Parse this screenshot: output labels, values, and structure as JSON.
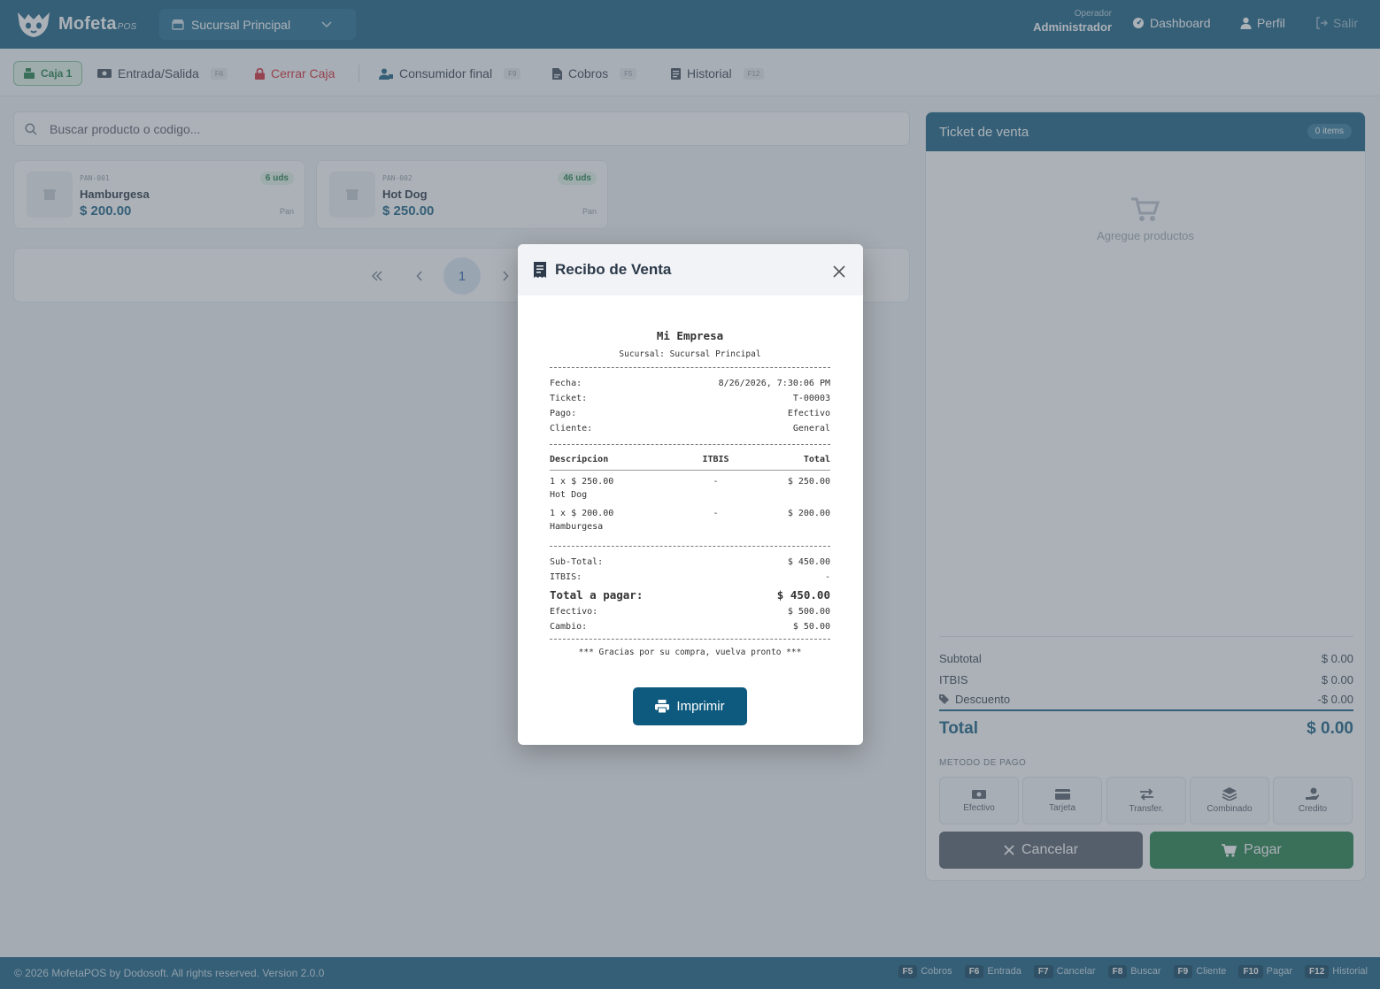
{
  "app": {
    "name": "Mofeta",
    "suffix": "POS"
  },
  "header": {
    "branch": "Sucursal Principal",
    "operator_label": "Operador",
    "operator_name": "Administrador",
    "dashboard": "Dashboard",
    "profile": "Perfil",
    "logout": "Salir"
  },
  "toolbar": {
    "register": "Caja 1",
    "cash_io": "Entrada/Salida",
    "cash_io_key": "F6",
    "close_register": "Cerrar Caja",
    "customer": "Consumidor final",
    "customer_key": "F9",
    "charges": "Cobros",
    "charges_key": "F5",
    "history": "Historial",
    "history_key": "F12"
  },
  "search": {
    "placeholder": "Buscar producto o codigo..."
  },
  "products": [
    {
      "sku": "PAN-001",
      "name": "Hamburgesa",
      "price": "$ 200.00",
      "stock": "6 uds",
      "category": "Pan"
    },
    {
      "sku": "PAN-002",
      "name": "Hot Dog",
      "price": "$ 250.00",
      "stock": "46 uds",
      "category": "Pan"
    }
  ],
  "pagination": {
    "current": "1"
  },
  "ticket": {
    "title": "Ticket de venta",
    "count": "0 items",
    "empty": "Agregue productos",
    "subtotal_label": "Subtotal",
    "subtotal": "$ 0.00",
    "tax_label": "ITBIS",
    "tax": "$ 0.00",
    "discount_label": "Descuento",
    "discount": "-$ 0.00",
    "total_label": "Total",
    "total": "$ 0.00",
    "payment_label": "METODO DE PAGO",
    "methods": [
      "Efectivo",
      "Tarjeta",
      "Transfer.",
      "Combinado",
      "Credito"
    ],
    "cancel": "Cancelar",
    "pay": "Pagar"
  },
  "footer": {
    "copyright": "© 2026 MofetaPOS by Dodosoft. All rights reserved. Version 2.0.0",
    "keys": [
      {
        "key": "F5",
        "label": "Cobros"
      },
      {
        "key": "F6",
        "label": "Entrada"
      },
      {
        "key": "F7",
        "label": "Cancelar"
      },
      {
        "key": "F8",
        "label": "Buscar"
      },
      {
        "key": "F9",
        "label": "Cliente"
      },
      {
        "key": "F10",
        "label": "Pagar"
      },
      {
        "key": "F12",
        "label": "Historial"
      }
    ]
  },
  "modal": {
    "title": "Recibo de Venta",
    "print": "Imprimir",
    "receipt": {
      "company": "Mi Empresa",
      "branch": "Sucursal: Sucursal Principal",
      "date_label": "Fecha:",
      "date": "8/26/2026, 7:30:06 PM",
      "ticket_label": "Ticket:",
      "ticket": "T-00003",
      "payment_label": "Pago:",
      "payment": "Efectivo",
      "client_label": "Cliente:",
      "client": "General",
      "col_desc": "Descripcion",
      "col_tax": "ITBIS",
      "col_total": "Total",
      "items": [
        {
          "qty": "1 x $ 250.00",
          "name": "Hot Dog",
          "tax": "-",
          "total": "$ 250.00"
        },
        {
          "qty": "1 x $ 200.00",
          "name": "Hamburgesa",
          "tax": "-",
          "total": "$ 200.00"
        }
      ],
      "subtotal_label": "Sub-Total:",
      "subtotal": "$ 450.00",
      "tax_label": "ITBIS:",
      "tax": "-",
      "total_label": "Total a pagar:",
      "total": "$ 450.00",
      "cash_label": "Efectivo:",
      "cash": "$ 500.00",
      "change_label": "Cambio:",
      "change": "$ 50.00",
      "thanks": "*** Gracias por su compra, vuelva pronto ***"
    }
  },
  "colors": {
    "primary": "#0e5a7e",
    "success": "#1a7a44",
    "danger": "#d0222e"
  }
}
